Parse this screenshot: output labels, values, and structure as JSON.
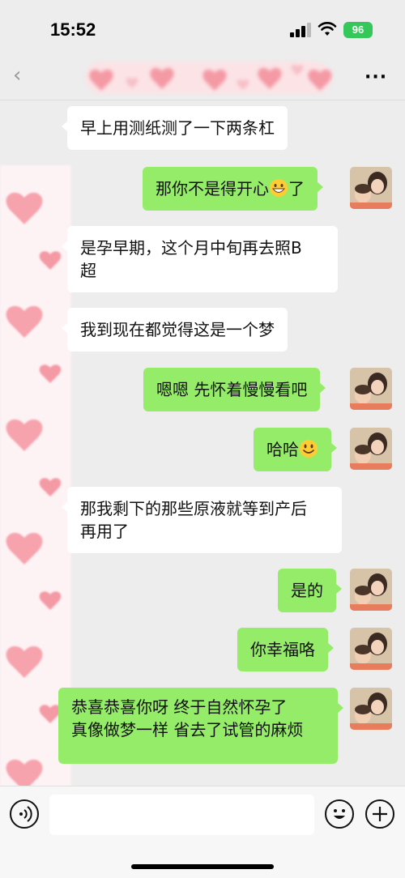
{
  "status_bar": {
    "time": "15:52",
    "battery": "96"
  },
  "nav": {
    "more": "···"
  },
  "messages": [
    {
      "side": "left",
      "text": "早上用测纸测了一下两条杠"
    },
    {
      "side": "right",
      "text": "那你不是得开心",
      "suffix": "了",
      "emoji": "grinning-face"
    },
    {
      "side": "left",
      "line1": "是孕早期，这个月中旬再去照B",
      "line2": "超"
    },
    {
      "side": "left",
      "text": "我到现在都觉得这是一个梦"
    },
    {
      "side": "right",
      "text": "嗯嗯 先怀着慢慢看吧"
    },
    {
      "side": "right",
      "text": "哈哈",
      "emoji": "smiling-face"
    },
    {
      "side": "left",
      "line1": "那我剩下的那些原液就等到产后",
      "line2": "再用了"
    },
    {
      "side": "right",
      "text": "是的"
    },
    {
      "side": "right",
      "text": "你幸福咯"
    },
    {
      "side": "right",
      "line1": "恭喜恭喜你呀 终于自然怀孕了",
      "line2": "真像做梦一样 省去了试管的麻烦"
    }
  ],
  "input": {
    "placeholder": ""
  },
  "icons": {
    "back": "chevron-left-icon",
    "more": "more-icon",
    "voice": "voice-icon",
    "emoji": "emoji-icon",
    "plus": "plus-icon"
  },
  "colors": {
    "bubble_right": "#95ec69",
    "bubble_left": "#ffffff",
    "background": "#ededed"
  }
}
